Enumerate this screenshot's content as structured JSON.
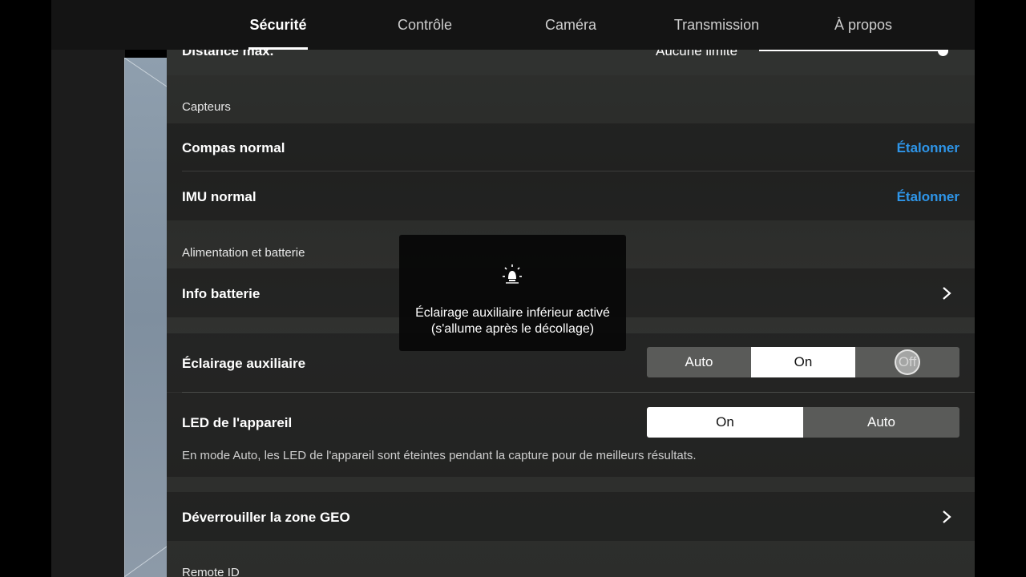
{
  "tabs": [
    {
      "label": "Sécurité",
      "active": true
    },
    {
      "label": "Contrôle",
      "active": false
    },
    {
      "label": "Caméra",
      "active": false
    },
    {
      "label": "Transmission",
      "active": false
    },
    {
      "label": "À propos",
      "active": false
    }
  ],
  "distance": {
    "label": "Distance max.",
    "value": "Aucune limite",
    "slider_level": 1.0
  },
  "sensors": {
    "title": "Capteurs",
    "compass": {
      "label": "Compas normal",
      "action": "Étalonner"
    },
    "imu": {
      "label": "IMU normal",
      "action": "Étalonner"
    }
  },
  "power": {
    "title": "Alimentation et batterie",
    "battery_info": {
      "label": "Info batterie"
    }
  },
  "aux_light": {
    "label": "Éclairage auxiliaire",
    "options": [
      "Auto",
      "On",
      "Off"
    ],
    "selected": "On"
  },
  "device_led": {
    "label": "LED de l'appareil",
    "options": [
      "On",
      "Auto"
    ],
    "selected": "On",
    "hint": "En mode Auto, les LED de l'appareil sont éteintes pendant la capture pour de meilleurs résultats."
  },
  "geo": {
    "label": "Déverrouiller la zone GEO"
  },
  "remote_id": {
    "title": "Remote ID"
  },
  "toast": {
    "icon": "light-bulb-icon",
    "line1": "Éclairage auxiliaire inférieur activé",
    "line2": "(s'allume après le décollage)"
  },
  "colors": {
    "accent": "#2e95e8",
    "panel": "#2c2d2b",
    "tabbar": "#141414"
  }
}
